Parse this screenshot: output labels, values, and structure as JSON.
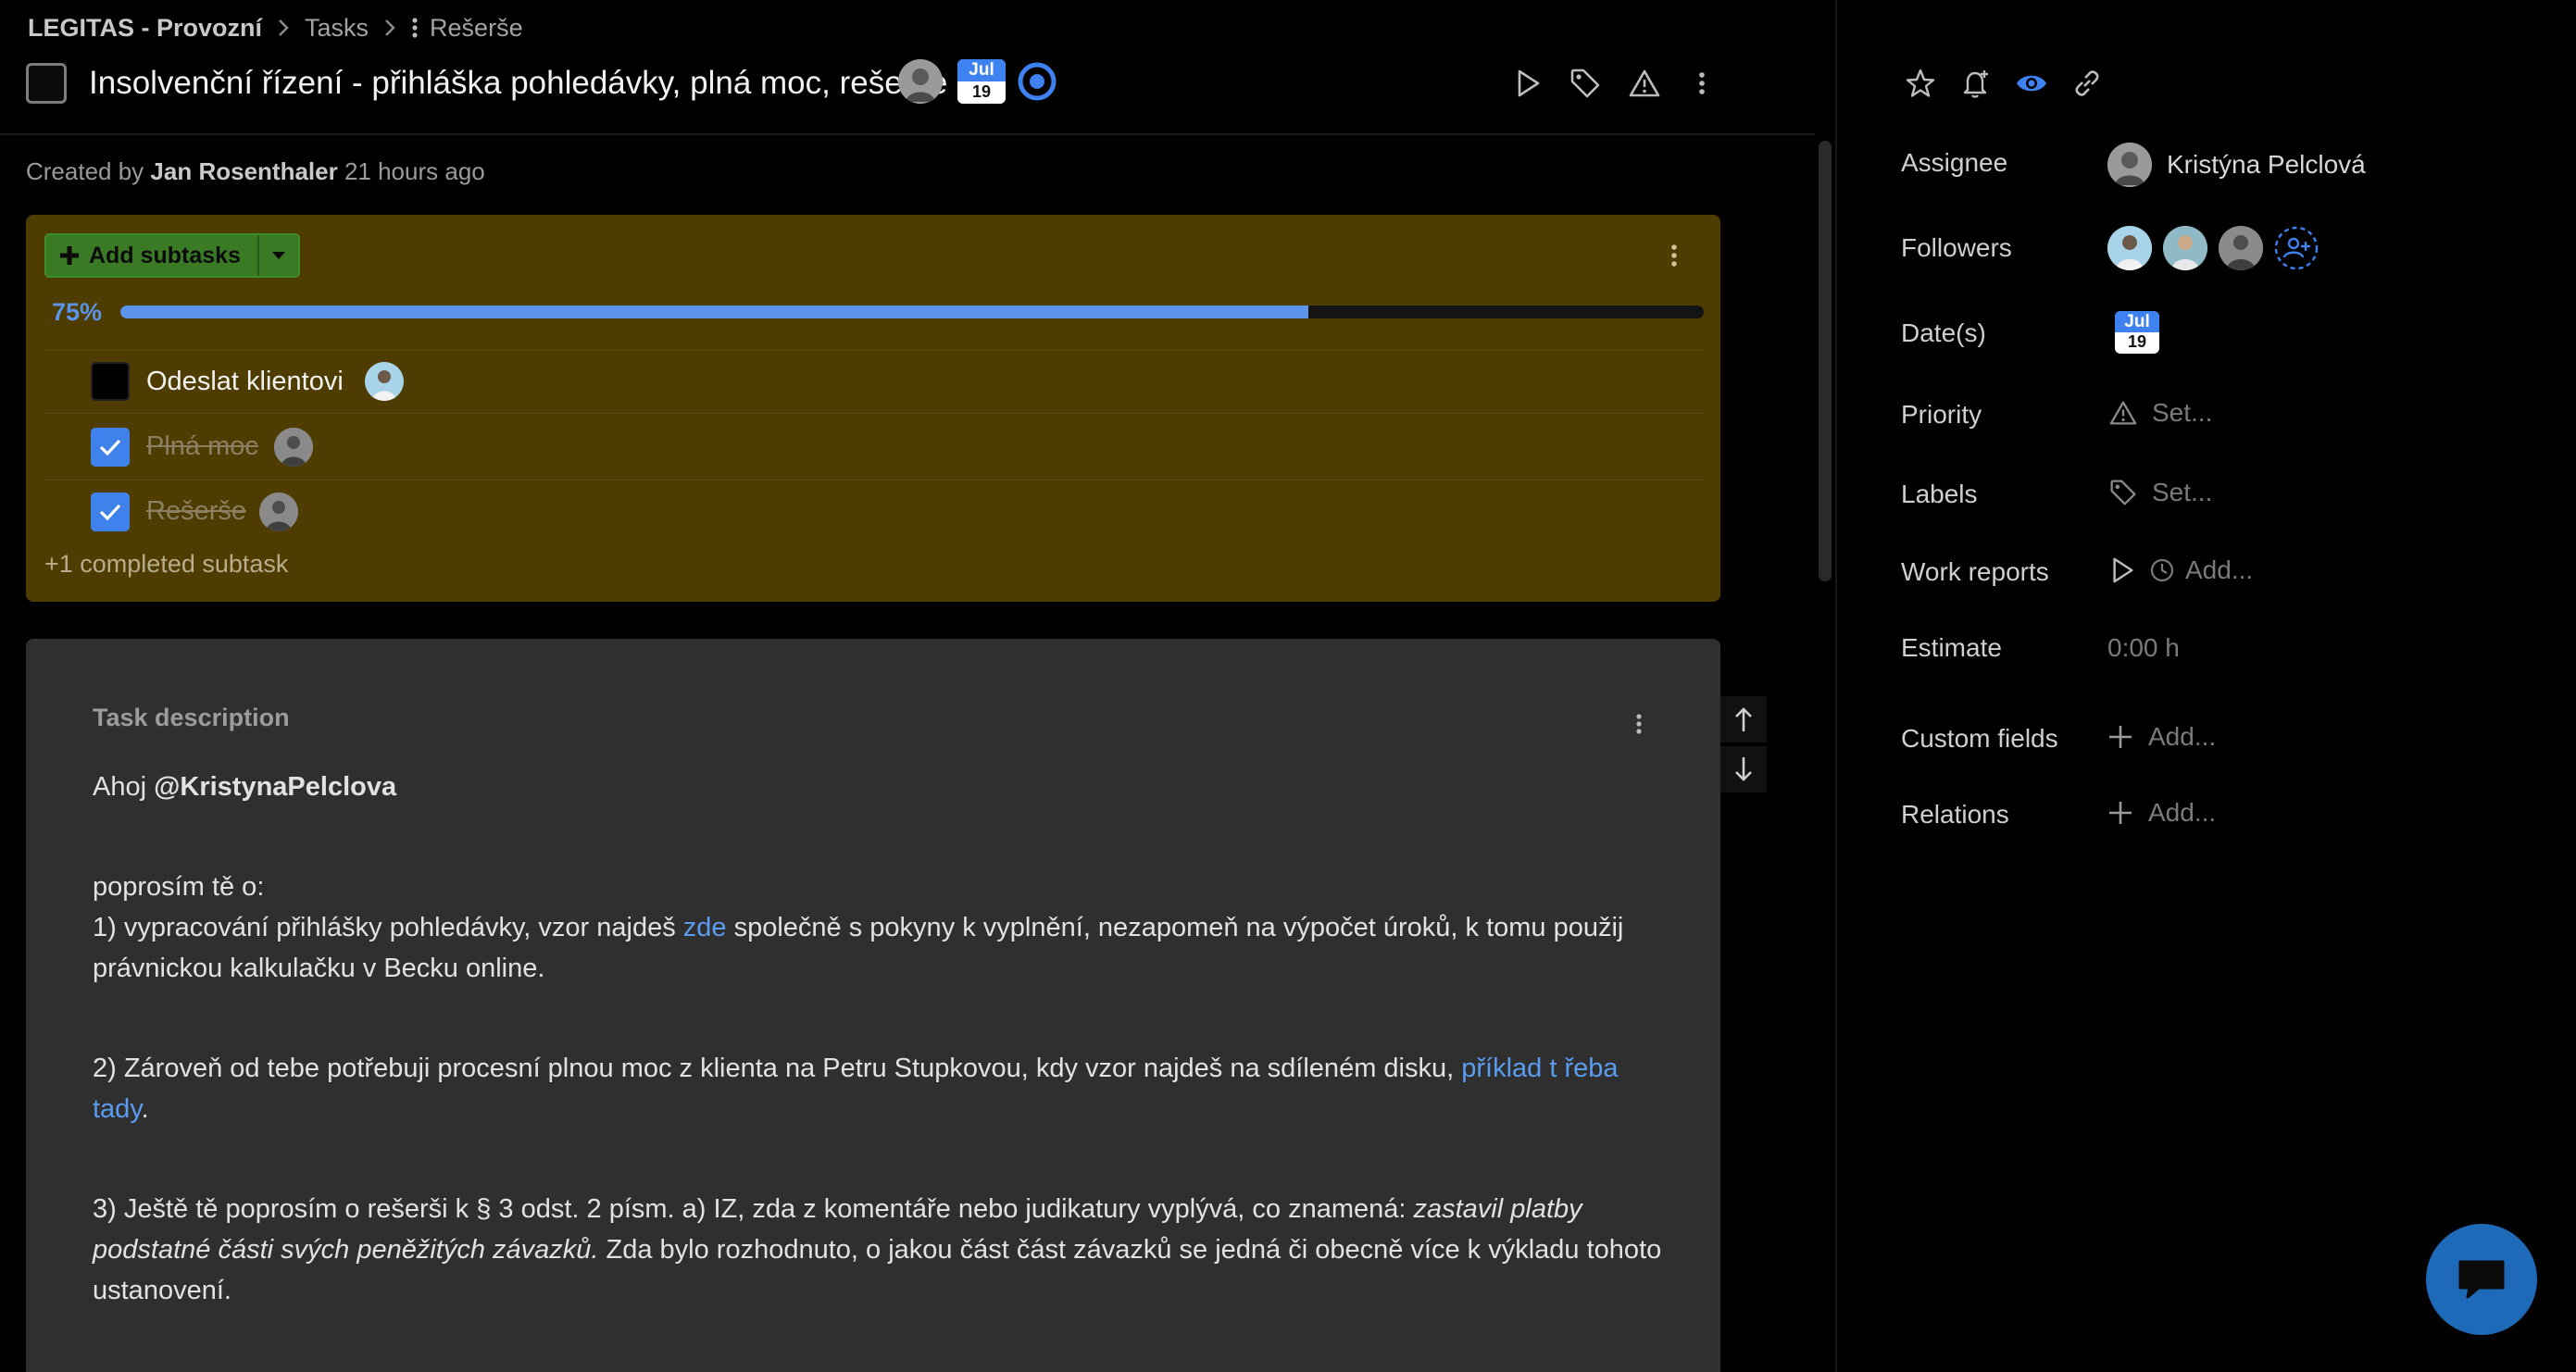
{
  "breadcrumb": {
    "root": "LEGITAS - Provozní",
    "section": "Tasks",
    "current": "Rešerše"
  },
  "task": {
    "title": "Insolvenční řízení - přihláška pohledávky, plná moc, rešerše",
    "due_month": "Jul",
    "due_day": "19",
    "created_prefix": "Created by",
    "created_by": "Jan Rosenthaler",
    "created_ago": "21 hours ago"
  },
  "toolbar": {
    "icons": [
      "play-icon",
      "tag-icon",
      "warning-icon",
      "more-vertical-icon",
      "star-icon",
      "bell-plus-icon",
      "eye-icon",
      "link-icon"
    ]
  },
  "subtasks": {
    "add_label": "Add subtasks",
    "progress_label": "75%",
    "progress_value": 0.75,
    "items": [
      {
        "label": "Odeslat klientovi",
        "done": false
      },
      {
        "label": "Plná moc",
        "done": true
      },
      {
        "label": "Rešerše",
        "done": true
      }
    ],
    "completed_more": "+1 completed subtask"
  },
  "description": {
    "heading": "Task description",
    "greeting": "Ahoj ",
    "mention": "@KristynaPelclova",
    "p0": "poprosím tě o:",
    "p1_a": "1) vypracování přihlášky pohledávky, vzor najdeš ",
    "p1_link": "zde",
    "p1_b": " společně s pokyny k vyplnění, nezapomeň na výpočet úroků, k tomu použij právnickou kalkulačku v Becku online.",
    "p2_a": "2) Zároveň od tebe potřebuji procesní plnou moc z klienta na Petru Stupkovou, kdy vzor najdeš na sdíleném disku, ",
    "p2_link": "příklad t řeba tady",
    "p2_b": ".",
    "p3_a": "3) Ještě tě poprosím o rešerši k § 3 odst. 2 písm. a) IZ, zda z komentáře nebo judikatury vyplývá, co znamená: ",
    "p3_italic": "zastavil platby podstatné části svých peněžitých závazků.",
    "p3_b": " Zda bylo rozhodnuto, o jakou část část závazků se jedná či obecně více k výkladu tohoto ustanovení."
  },
  "properties": {
    "assignee_label": "Assignee",
    "assignee_name": "Kristýna Pelclová",
    "followers_label": "Followers",
    "dates_label": "Date(s)",
    "date_month": "Jul",
    "date_day": "19",
    "priority_label": "Priority",
    "priority_value": "Set...",
    "labels_label": "Labels",
    "labels_value": "Set...",
    "work_label": "Work reports",
    "work_value": "Add...",
    "estimate_label": "Estimate",
    "estimate_value": "0:00 h",
    "custom_label": "Custom fields",
    "custom_value": "Add...",
    "relations_label": "Relations",
    "relations_value": "Add..."
  },
  "colors": {
    "accent": "#5b94e8",
    "subtask_panel": "#4e3c00",
    "add_button": "#3a7a25",
    "description_bg": "#2f2f2f",
    "chat_button": "#1f6ab8"
  }
}
